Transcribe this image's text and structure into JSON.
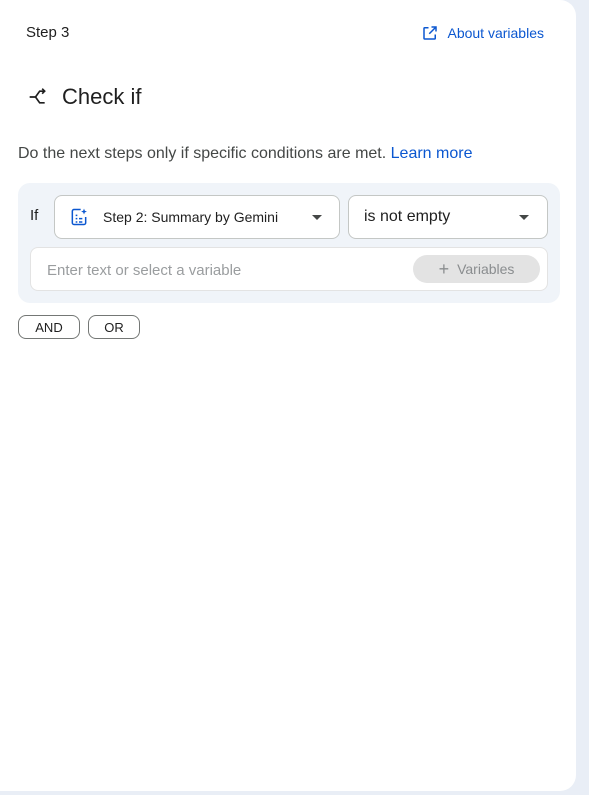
{
  "step": {
    "label": "Step 3"
  },
  "about_link": {
    "label": "About variables",
    "icon": "open-in-new-icon"
  },
  "title": {
    "text": "Check if",
    "icon": "branch-icon"
  },
  "description": {
    "text": "Do the next steps only if specific conditions are met.",
    "link": "Learn more"
  },
  "condition": {
    "if_label": "If",
    "variable": {
      "label": "Step 2: Summary by Gemini",
      "icon": "gemini-summary-icon"
    },
    "operator": {
      "label": "is not empty"
    },
    "value_input": {
      "placeholder": "Enter text or select a variable",
      "value": ""
    },
    "variables_button": {
      "label": "Variables"
    }
  },
  "logic_buttons": {
    "and": "AND",
    "or": "OR"
  },
  "colors": {
    "accent": "#0b57d0",
    "condition_bg": "#f0f4f9",
    "page_bg": "#e9eef6"
  }
}
